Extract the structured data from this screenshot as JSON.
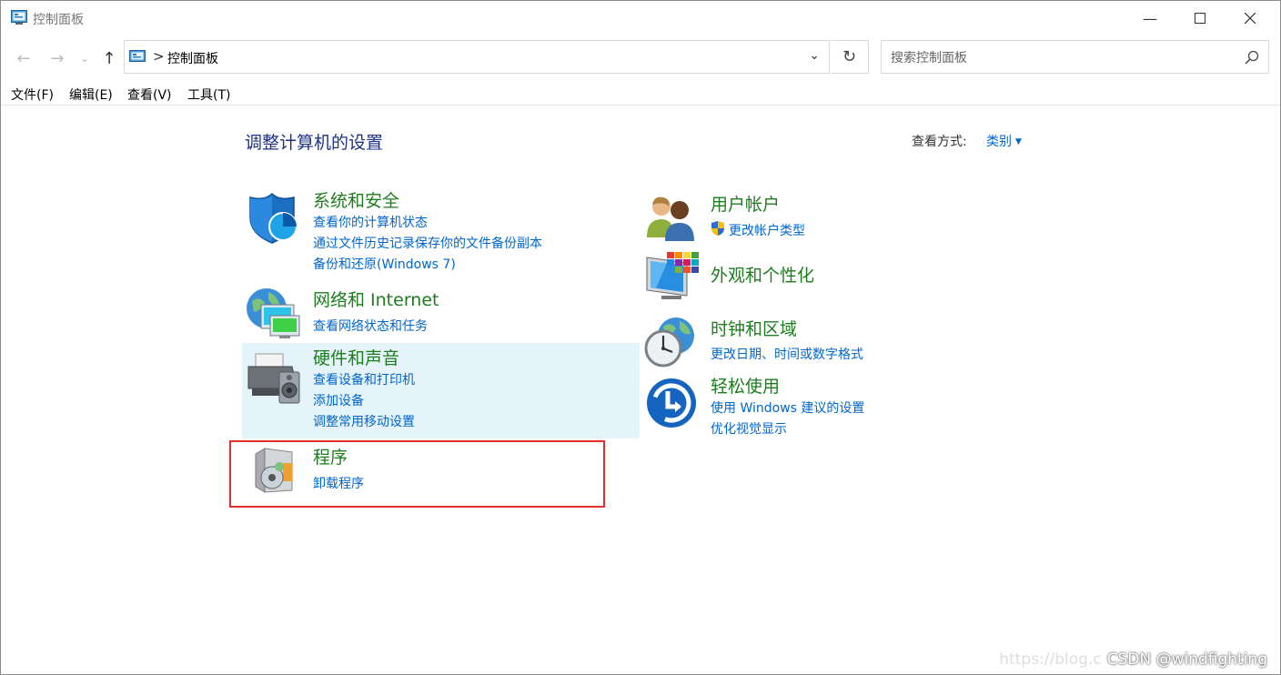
{
  "window": {
    "title": "控制面板"
  },
  "address": {
    "crumb": "控制面板",
    "separator": ">"
  },
  "search": {
    "placeholder": "搜索控制面板"
  },
  "menu": [
    {
      "label": "文件(F)"
    },
    {
      "label": "编辑(E)"
    },
    {
      "label": "查看(V)"
    },
    {
      "label": "工具(T)"
    }
  ],
  "content": {
    "heading": "调整计算机的设置",
    "view_by_label": "查看方式:",
    "view_by_value": "类别"
  },
  "categories": {
    "system": {
      "title": "系统和安全",
      "links": [
        "查看你的计算机状态",
        "通过文件历史记录保存你的文件备份副本",
        "备份和还原(Windows 7)"
      ],
      "icon": "shield-icon"
    },
    "network": {
      "title": "网络和 Internet",
      "links": [
        "查看网络状态和任务"
      ],
      "icon": "network-globe-icon"
    },
    "hardware": {
      "title": "硬件和声音",
      "links": [
        "查看设备和打印机",
        "添加设备",
        "调整常用移动设置"
      ],
      "icon": "printer-speaker-icon"
    },
    "programs": {
      "title": "程序",
      "links": [
        "卸载程序"
      ],
      "icon": "programs-disc-icon"
    },
    "users": {
      "title": "用户帐户",
      "links": [
        "更改帐户类型"
      ],
      "icon": "users-icon"
    },
    "appearance": {
      "title": "外观和个性化",
      "links": [],
      "icon": "monitor-palette-icon"
    },
    "clock": {
      "title": "时钟和区域",
      "links": [
        "更改日期、时间或数字格式"
      ],
      "icon": "clock-globe-icon"
    },
    "ease": {
      "title": "轻松使用",
      "links": [
        "使用 Windows 建议的设置",
        "优化视觉显示"
      ],
      "icon": "ease-of-access-icon"
    }
  },
  "watermark": {
    "faint": "https://blog.c",
    "text": "CSDN @windfighting"
  },
  "colors": {
    "category_title": "#1e7d1e",
    "link": "#0066cc",
    "heading": "#1e3287",
    "highlight_bg": "#e5f3fb",
    "annotation_box": "#e03030"
  }
}
